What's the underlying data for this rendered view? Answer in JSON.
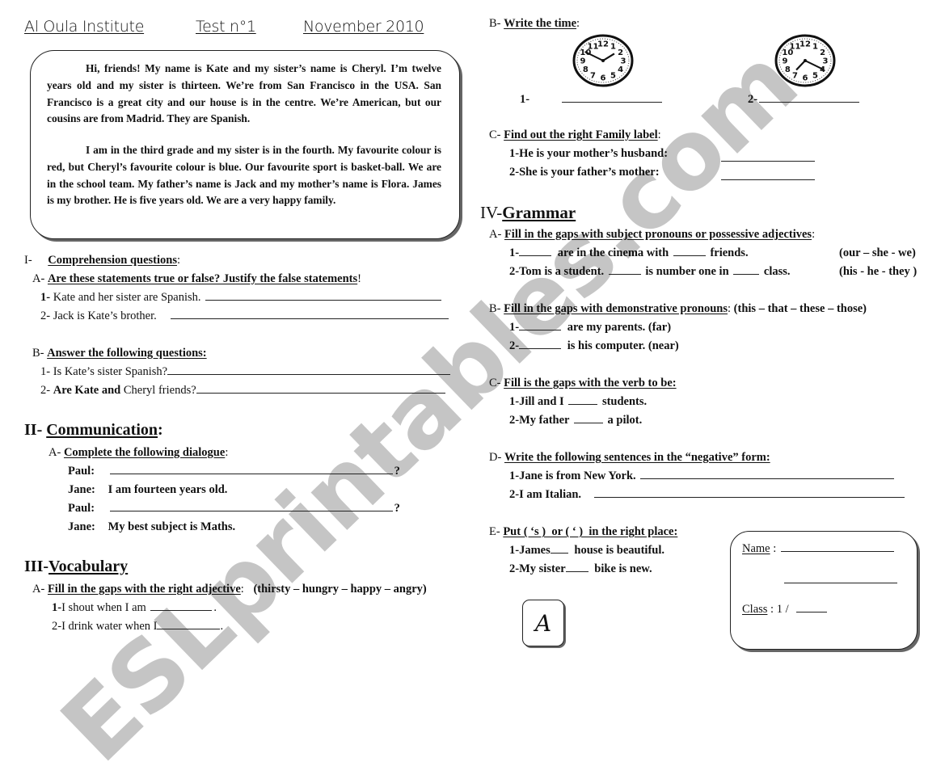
{
  "header": {
    "institute": "Al Oula Institute",
    "test": "Test n°1",
    "date": "November 2010"
  },
  "passage": {
    "paragraph1": "Hi, friends! My name is Kate and my sister’s name is Cheryl. I’m twelve years old and my sister is thirteen. We’re from San Francisco in the USA. San Francisco is a great city and our house is in the centre. We’re American, but our cousins are from Madrid. They are Spanish.",
    "paragraph2": "I am in the third grade and my sister is in the fourth. My favourite colour is red, but Cheryl’s favourite colour is blue. Our favourite sport is basket-ball. We are in the school team. My father’s name is Jack and my mother’s name is Flora. James is my brother. He is five years old. We are a very happy family."
  },
  "section1": {
    "number": "I-",
    "title": "Comprehension questions",
    "partA": {
      "label": "A-",
      "title": "Are these statements true or false? Justify the false statements",
      "items": [
        {
          "num": "1-",
          "text": "Kate and her sister are Spanish."
        },
        {
          "num": "2-",
          "text": "Jack is Kate’s brother."
        }
      ]
    },
    "partB": {
      "label": "B-",
      "title": "Answer the following questions:",
      "items": [
        {
          "num": "1-",
          "text": "Is Kate’s sister Spanish?"
        },
        {
          "num": "2-",
          "text_bold": "Are Kate and",
          "text": "Cheryl friends?"
        }
      ]
    }
  },
  "section2": {
    "number": "II-",
    "title": "Communication",
    "partA": {
      "label": "A-",
      "title": "Complete the following dialogue",
      "lines": [
        {
          "speaker": "Paul:",
          "text": "",
          "end": "?"
        },
        {
          "speaker": "Jane:",
          "text": "I am fourteen years old."
        },
        {
          "speaker": "Paul:",
          "text": "",
          "end": "?"
        },
        {
          "speaker": "Jane:",
          "text": "My best subject is Maths."
        }
      ]
    }
  },
  "section3": {
    "number": "III-",
    "title": "Vocabulary",
    "partA": {
      "label": "A-",
      "title": "Fill in the gaps with the right adjective",
      "options": "(thirsty – hungry – happy – angry)",
      "items": [
        {
          "num": "1-",
          "text": "I shout when I am"
        },
        {
          "num": "2-",
          "text": "I drink water when I"
        }
      ]
    }
  },
  "right": {
    "partB": {
      "label": "B-",
      "title": "Write the time",
      "clocks": [
        {
          "num": "1-",
          "hour": 1,
          "minute": 50
        },
        {
          "num": "2-",
          "hour": 7,
          "minute": 20
        }
      ]
    },
    "partC": {
      "label": "C-",
      "title": "Find out the right Family label",
      "items": [
        {
          "num": "1-",
          "text": "He is your mother’s husband:"
        },
        {
          "num": "2-",
          "text": "She is your father’s mother:"
        }
      ]
    }
  },
  "section4": {
    "number": "IV-",
    "title": "Grammar",
    "partA": {
      "label": "A-",
      "title": "Fill in the gaps with subject pronouns or possessive adjectives",
      "items": [
        {
          "num": "1-",
          "pre": "",
          "mid": "are in the cinema with",
          "post": "friends.",
          "hint": "(our – she - we)"
        },
        {
          "num": "2-",
          "pre": "Tom is a student.",
          "mid": "is number one in",
          "post": "class.",
          "hint": "(his - he - they )"
        }
      ]
    },
    "partB": {
      "label": "B-",
      "title": "Fill in the gaps with demonstrative pronouns",
      "options": "(this – that – these – those)",
      "items": [
        {
          "num": "1-",
          "text": "are my parents. (far)"
        },
        {
          "num": "2-",
          "text": "is his computer. (near)"
        }
      ]
    },
    "partC": {
      "label": "C-",
      "title": "Fill is the gaps with the verb to be:",
      "items": [
        {
          "num": "1-",
          "pre": "Jill and I",
          "post": "students."
        },
        {
          "num": "2-",
          "pre": "My father",
          "post": "a pilot."
        }
      ]
    },
    "partD": {
      "label": "D-",
      "title": "Write the following sentences in the “negative” form:",
      "items": [
        {
          "num": "1-",
          "text": "Jane is from New York."
        },
        {
          "num": "2-",
          "text": "I am Italian."
        }
      ]
    },
    "partE": {
      "label": "E-",
      "title": "Put ( ‘s )  or ( ‘ )  in the right place:",
      "items": [
        {
          "num": "1-",
          "pre": "James",
          "post": "house is beautiful."
        },
        {
          "num": "2-",
          "pre": "My sister",
          "post": "bike is new."
        }
      ]
    }
  },
  "grade_box": {
    "letter": "A"
  },
  "name_box": {
    "name_label": "Name",
    "class_label": "Class",
    "class_prefix": "1 /"
  },
  "watermark": "ESLprintables.com"
}
